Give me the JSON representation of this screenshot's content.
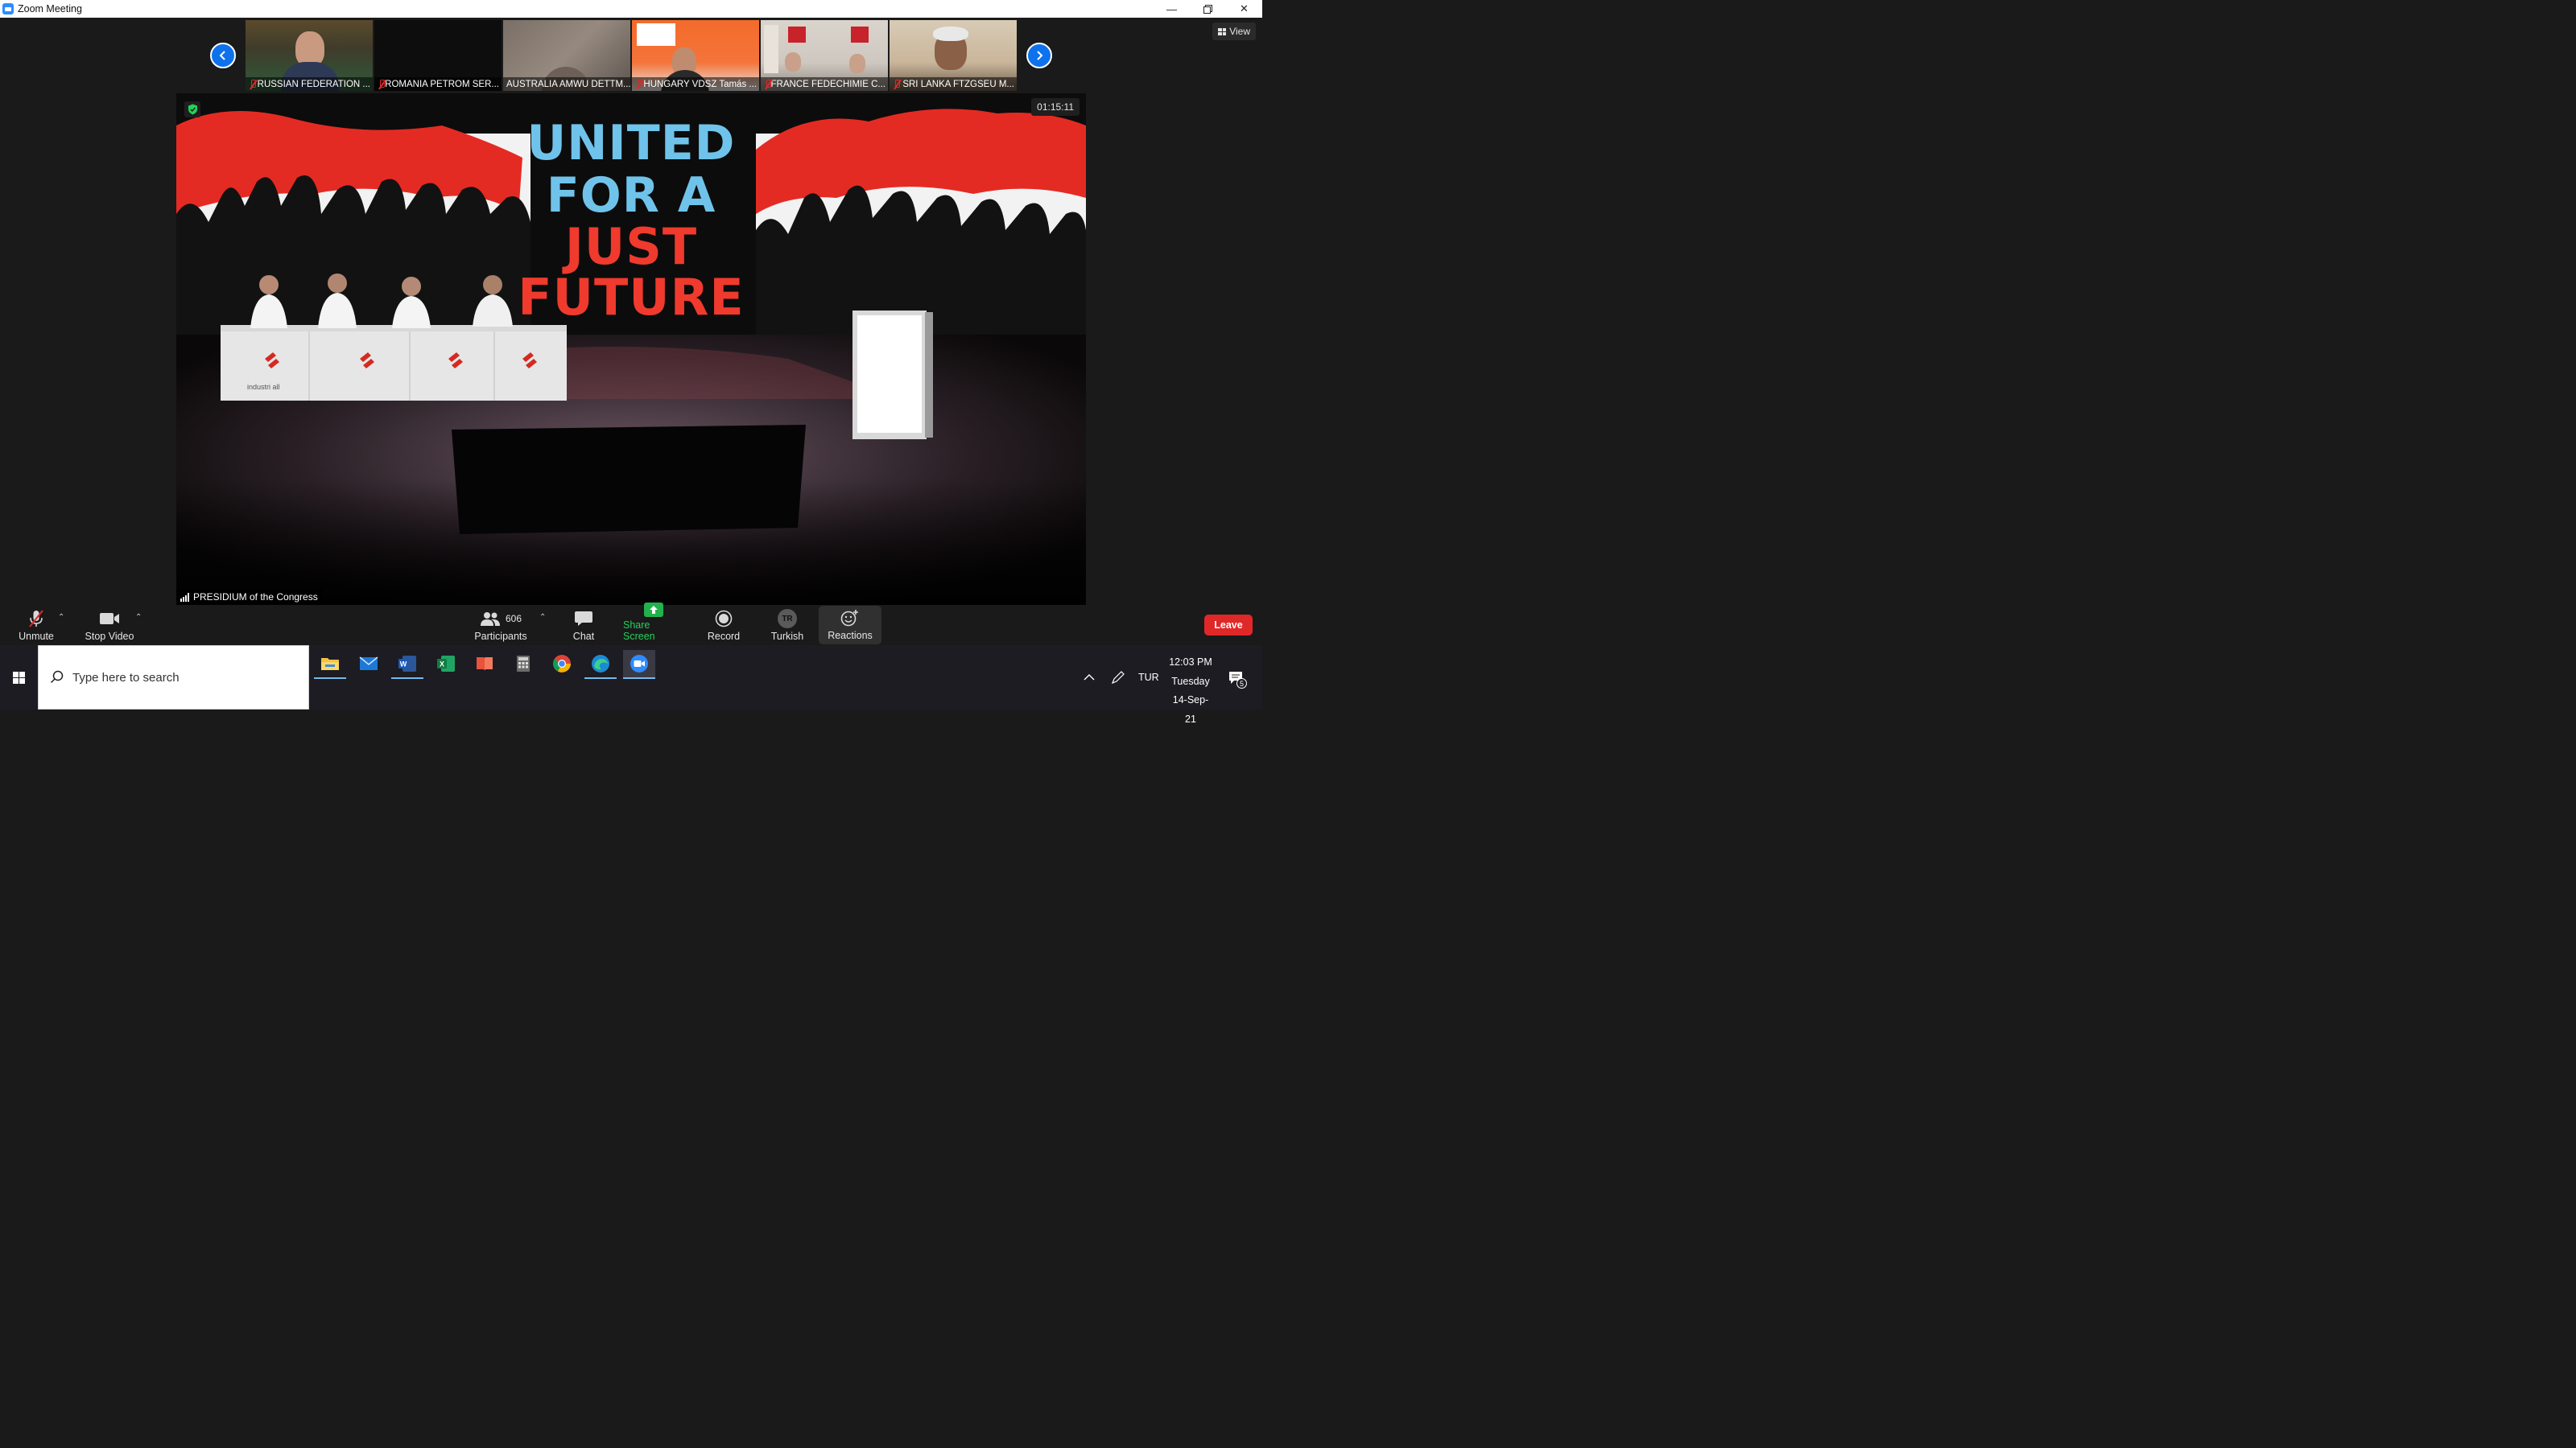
{
  "window": {
    "title": "Zoom Meeting"
  },
  "view_button": {
    "label": "View"
  },
  "participants_strip": [
    {
      "name": "RUSSIAN FEDERATION ...",
      "muted": true
    },
    {
      "name": "ROMANIA PETROM SER...",
      "muted": true
    },
    {
      "name": "AUSTRALIA AMWU DETTM...",
      "muted": false
    },
    {
      "name": "HUNGARY VDSZ Tamás ...",
      "muted": true
    },
    {
      "name": "FRANCE FEDECHIMIE C...",
      "muted": true
    },
    {
      "name": "SRI LANKA FTZGSEU M...",
      "muted": true
    }
  ],
  "main_video": {
    "timer": "01:15:11",
    "speaker_label": "PRESIDIUM of the Congress",
    "banner_lines": [
      "UNITED",
      "FOR A",
      "JUST",
      "FUTURE"
    ],
    "desk_logo_text": "industri all"
  },
  "toolbar": {
    "unmute": "Unmute",
    "stop_video": "Stop Video",
    "participants_count": "606",
    "participants": "Participants",
    "chat": "Chat",
    "share_screen": "Share Screen",
    "record": "Record",
    "language_badge": "TR",
    "language": "Turkish",
    "reactions": "Reactions",
    "leave": "Leave"
  },
  "taskbar": {
    "search_placeholder": "Type here to search",
    "input_language": "TUR",
    "time": "12:03 PM",
    "day": "Tuesday",
    "date": "14-Sep-21",
    "notification_count": "5"
  },
  "colors": {
    "zoom_blue": "#0e72ed",
    "leave_red": "#e02828",
    "share_green": "#22b14c",
    "headline_blue": "#6fc3ea",
    "headline_red": "#ef3a2d"
  }
}
